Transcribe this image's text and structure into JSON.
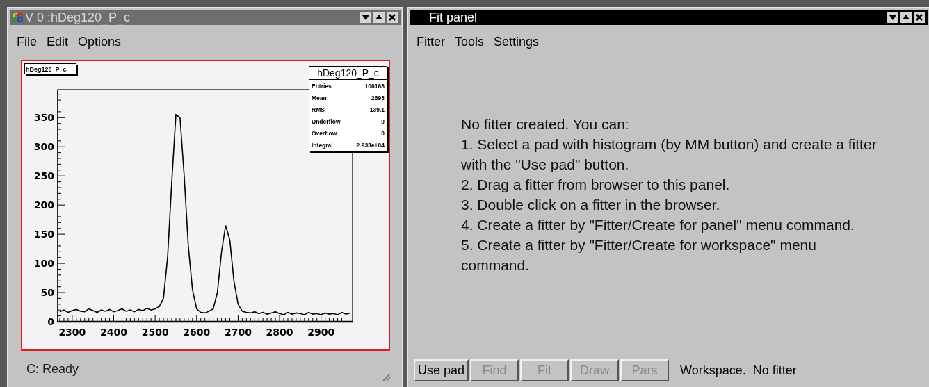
{
  "viewer": {
    "title": "V 0 :hDeg120_P_c",
    "active": false,
    "menu": [
      "File",
      "Edit",
      "Options"
    ],
    "canvas": {
      "stats": {
        "title": "hDeg120_P_c",
        "rows": [
          {
            "label": "Entries",
            "value": "106168"
          },
          {
            "label": "Mean",
            "value": "2693"
          },
          {
            "label": "RMS",
            "value": "139.1"
          },
          {
            "label": "Underflow",
            "value": "0"
          },
          {
            "label": "Overflow",
            "value": "0"
          },
          {
            "label": "Integral",
            "value": "2.933e+04"
          }
        ]
      },
      "chart_data": {
        "type": "line",
        "x": [
          2270,
          2280,
          2290,
          2300,
          2310,
          2320,
          2330,
          2340,
          2350,
          2360,
          2370,
          2380,
          2390,
          2400,
          2410,
          2420,
          2430,
          2440,
          2450,
          2460,
          2470,
          2480,
          2490,
          2500,
          2510,
          2520,
          2530,
          2540,
          2550,
          2560,
          2570,
          2580,
          2590,
          2600,
          2610,
          2620,
          2630,
          2640,
          2650,
          2660,
          2670,
          2680,
          2690,
          2700,
          2710,
          2720,
          2730,
          2740,
          2750,
          2760,
          2770,
          2780,
          2790,
          2800,
          2810,
          2820,
          2830,
          2840,
          2850,
          2860,
          2870,
          2880,
          2890,
          2900,
          2910,
          2920,
          2930,
          2940,
          2950,
          2960,
          2970
        ],
        "series": [
          {
            "name": "hDeg120_P_c",
            "color": "#000000",
            "values": [
              17,
              20,
              16,
              19,
              21,
              18,
              17,
              22,
              19,
              16,
              20,
              18,
              21,
              17,
              19,
              22,
              18,
              20,
              17,
              21,
              19,
              23,
              20,
              22,
              26,
              40,
              110,
              240,
              355,
              350,
              250,
              130,
              55,
              22,
              16,
              15,
              18,
              22,
              50,
              120,
              165,
              140,
              70,
              30,
              18,
              16,
              15,
              17,
              14,
              16,
              13,
              15,
              17,
              14,
              12,
              16,
              13,
              15,
              14,
              12,
              16,
              13,
              14,
              12,
              15,
              13,
              14,
              12,
              16,
              13,
              15
            ]
          }
        ],
        "xlim": [
          2265,
          2976
        ],
        "ylim": [
          0,
          398
        ],
        "xticks": [
          2300,
          2400,
          2500,
          2600,
          2700,
          2800,
          2900
        ],
        "yticks": [
          0,
          50,
          100,
          150,
          200,
          250,
          300,
          350
        ]
      }
    },
    "status": "C: Ready"
  },
  "fit_panel": {
    "title": "Fit panel",
    "active": true,
    "menu": [
      "Fitter",
      "Tools",
      "Settings"
    ],
    "message": [
      "No fitter created. You can:",
      "1. Select a pad with histogram (by MM button) and create a fitter with the \"Use pad\" button.",
      "2. Drag a fitter from browser to this panel.",
      "3. Double click on a fitter in the browser.",
      "4. Create a fitter by \"Fitter/Create for panel\" menu command.",
      "5. Create a fitter by \"Fitter/Create for workspace\" menu command."
    ],
    "buttons": [
      {
        "label": "Use pad",
        "disabled": false
      },
      {
        "label": "Find",
        "disabled": true
      },
      {
        "label": "Fit",
        "disabled": true
      },
      {
        "label": "Draw",
        "disabled": true
      },
      {
        "label": "Pars",
        "disabled": true
      }
    ],
    "status": "Workspace.  No fitter"
  }
}
